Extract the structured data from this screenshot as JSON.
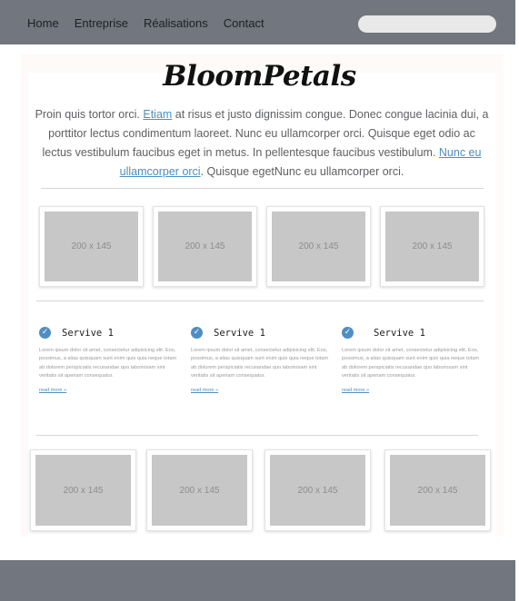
{
  "nav": {
    "items": [
      "Home",
      "Entreprise",
      "Réalisations",
      "Contact"
    ]
  },
  "search": {
    "placeholder": ""
  },
  "brand": "BloomPetals",
  "intro": {
    "p1": "Proin quis tortor orci. ",
    "link1": "Etiam",
    "p2": " at risus et justo dignissim congue. Donec congue lacinia dui, a porttitor lectus condimentum laoreet. Nunc eu ullamcorper orci. Quisque eget odio ac lectus vestibulum faucibus eget in metus. In pellentesque faucibus vestibulum. ",
    "link2": "Nunc eu ullamcorper orci",
    "p3": ". Quisque egetNunc eu ullamcorper orci."
  },
  "gallery_top": [
    "200 x 145",
    "200 x 145",
    "200 x 145",
    "200 x 145"
  ],
  "services": [
    {
      "title": "Servive 1",
      "text": "Lorem ipsum dolor sit amet, consectetur adipisicing elit. Eos, possimus, a alias quisquam sunt enim quis quia neque totam ab dolorem perspiciatis recusandae quo laboriosam sint veritatis sit aperiam consequatur.",
      "more": "read more »"
    },
    {
      "title": "Servive 1",
      "text": "Lorem ipsum dolor sit amet, consectetur adipisicing elit. Eos, possimus, a alias quisquam sunt enim quis quia neque totam ab dolorem perspiciatis recusandae quo laboriosam sint veritatis sit aperiam consequatur.",
      "more": "read more »"
    },
    {
      "title": "Servive 1",
      "text": "Lorem ipsum dolor sit amet, consectetur adipisicing elit. Eos, possimus, a alias quisquam sunt enim quis quia neque totam ab dolorem perspiciatis recusandae quo laboriosam sint veritatis sit aperiam consequatur.",
      "more": "read more »"
    }
  ],
  "gallery_bottom": [
    "200 x 145",
    "200 x 145",
    "200 x 145",
    "200 x 145"
  ],
  "icons": {
    "service": "check-circle-icon"
  },
  "colors": {
    "bar": "#71767f",
    "link": "#4a8fbf",
    "check": "#4d8fc4",
    "placeholder": "#c7c7c7"
  }
}
